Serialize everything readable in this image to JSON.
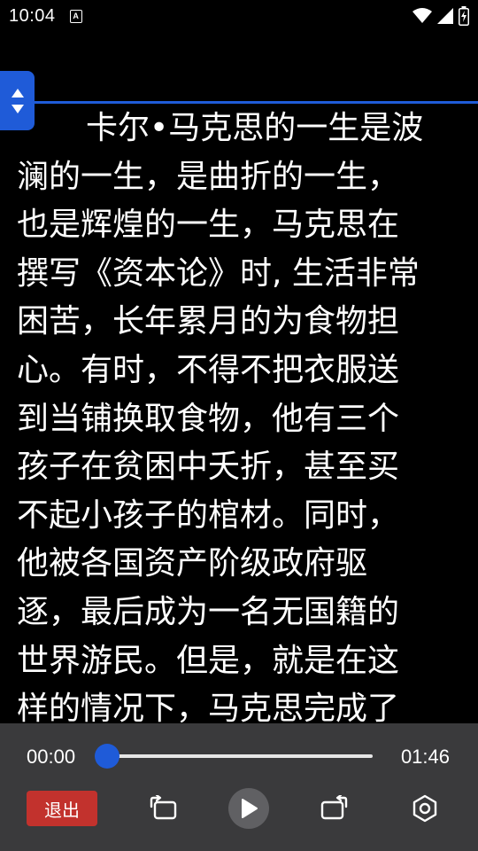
{
  "status_bar": {
    "time": "10:04",
    "notification_icon": "a-box-icon",
    "icons": [
      "wifi-icon",
      "signal-icon",
      "battery-charging-icon"
    ]
  },
  "reader": {
    "lines": [
      "卡尔•马克思的一生是波",
      "澜的一生，是曲折的一生，",
      "也是辉煌的一生，马克思在",
      "撰写《资本论》时, 生活非常",
      "困苦，长年累月的为食物担",
      "心。有时，不得不把衣服送",
      "到当铺换取食物，他有三个",
      "孩子在贫困中夭折，甚至买",
      "不起小孩子的棺材。同时，",
      "他被各国资产阶级政府驱",
      "逐，最后成为一名无国籍的",
      "世界游民。但是，就是在这",
      "样的情况下，马克思完成了"
    ]
  },
  "player": {
    "current_time": "00:00",
    "total_time": "01:46",
    "progress": 0,
    "exit_label": "退出"
  },
  "colors": {
    "accent": "#1f5bd8",
    "exit": "#c2322d",
    "panel": "#3a3a3c"
  }
}
